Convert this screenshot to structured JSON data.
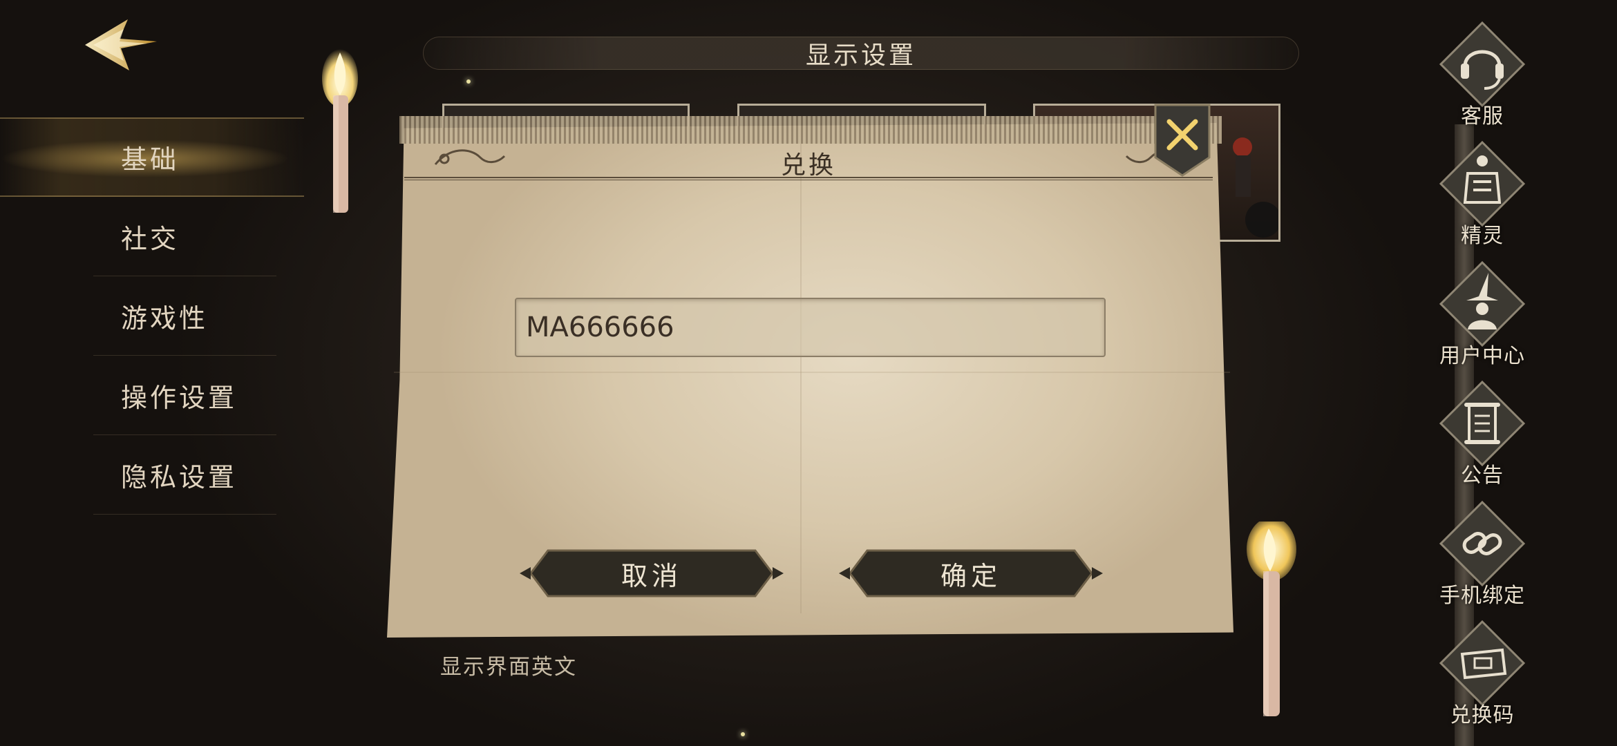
{
  "header": {
    "title": "显示设置"
  },
  "sidebar": {
    "items": [
      {
        "label": "基础",
        "active": true
      },
      {
        "label": "社交",
        "active": false
      },
      {
        "label": "游戏性",
        "active": false
      },
      {
        "label": "操作设置",
        "active": false
      },
      {
        "label": "隐私设置",
        "active": false
      }
    ]
  },
  "dialog": {
    "title": "兑换",
    "input_value": "MA666666",
    "cancel_label": "取消",
    "confirm_label": "确定"
  },
  "main": {
    "sub_label": "显示界面英文"
  },
  "right_rail": {
    "items": [
      {
        "label": "客服",
        "icon": "headset-icon"
      },
      {
        "label": "精灵",
        "icon": "house-elf-icon"
      },
      {
        "label": "用户中心",
        "icon": "wizard-hat-icon"
      },
      {
        "label": "公告",
        "icon": "scroll-icon"
      },
      {
        "label": "手机绑定",
        "icon": "chain-link-icon"
      },
      {
        "label": "兑换码",
        "icon": "ticket-icon"
      }
    ]
  },
  "colors": {
    "accent_gold": "#d9b45a",
    "paper": "#e2d4bb",
    "button_dark": "#2e2a22",
    "text_light": "#e2d5c0"
  }
}
